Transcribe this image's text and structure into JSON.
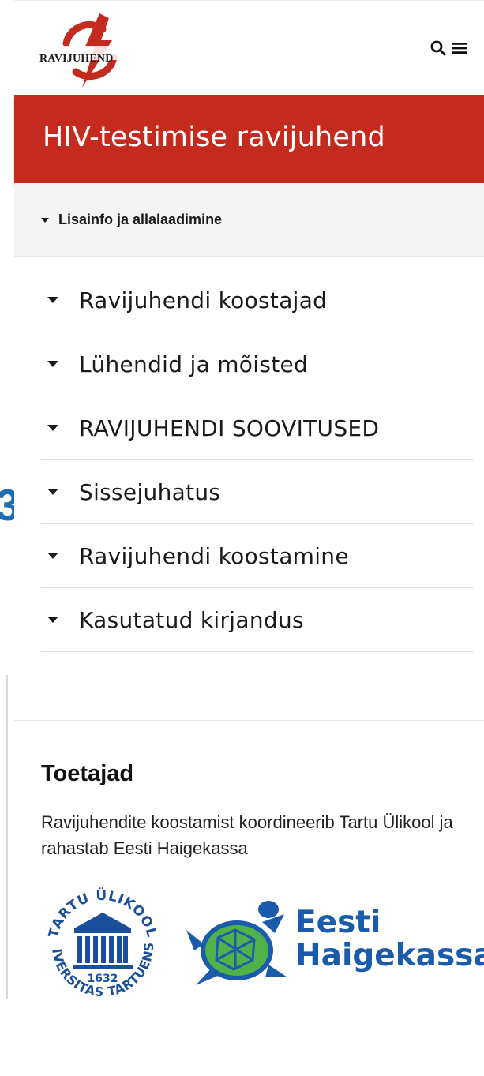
{
  "header": {
    "logo_text": "RAVIJUHEND",
    "search_icon": "search-icon",
    "menu_icon": "menu-icon"
  },
  "title": "HIV-testimise ravijuhend",
  "info_bar": {
    "label": "Lisainfo ja allalaadimine"
  },
  "toc": {
    "items": [
      {
        "label": "Ravijuhendi koostajad"
      },
      {
        "label": "Lühendid ja mõisted"
      },
      {
        "label": "RAVIJUHENDI SOOVITUSED"
      },
      {
        "label": "Sissejuhatus"
      },
      {
        "label": "Ravijuhendi koostamine"
      },
      {
        "label": "Kasutatud kirjandus"
      }
    ]
  },
  "supporters": {
    "title": "Toetajad",
    "text": "Ravijuhendite koostamist koordineerib Tartu Ülikool ja rahastab Eesti Haigekassa",
    "tartu_logo": {
      "top_text": "TARTU ÜLIKOOL",
      "ring_text": "UNIVERSITAS TARTUENSIS",
      "year": "1632"
    },
    "haigekassa_logo": {
      "line1": "Eesti",
      "line2": "Haigekassa"
    }
  },
  "colors": {
    "brand_red": "#c42a1e",
    "haigekassa_blue": "#1b5bab",
    "haigekassa_green": "#4fb34a",
    "tartu_blue": "#1b4f9c"
  }
}
